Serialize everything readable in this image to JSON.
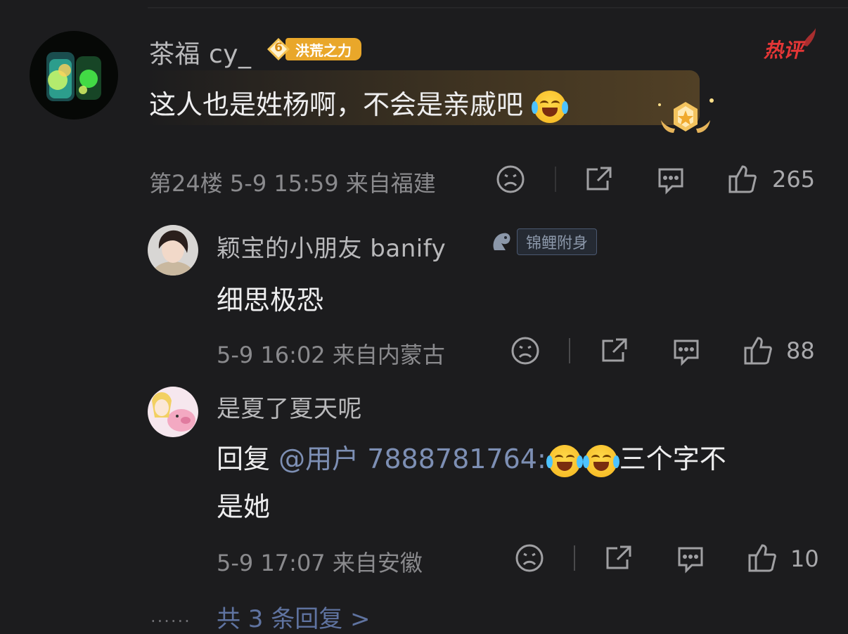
{
  "main_comment": {
    "username": "茶福 cy_",
    "level": "6",
    "badge_label": "洪荒之力",
    "hot_label": "热评",
    "text": "这人也是姓杨啊，不会是亲戚吧",
    "floor": "第24楼",
    "date": "5-9 15:59",
    "location": "来自福建",
    "likes": "265"
  },
  "replies": [
    {
      "username": "颖宝的小朋友 banify",
      "badge_label": "锦鲤附身",
      "text": "细思极恐",
      "date": "5-9 16:02",
      "location": "来自内蒙古",
      "likes": "88"
    },
    {
      "username": "是夏了夏天呢",
      "reply_prefix": "回复",
      "mention": "@用户 7888781764:",
      "text_after_emoji": "三个字不",
      "text_line2": "是她",
      "date": "5-9 17:07",
      "location": "来自安徽",
      "likes": "10"
    }
  ],
  "more_replies": "共 3 条回复 >",
  "icons": [
    "dislike-icon",
    "share-icon",
    "comment-icon",
    "like-icon",
    "laugh-cry-emoji"
  ],
  "colors": {
    "background": "#1c1c1e",
    "badge_orange": "#e9a72a",
    "hot_red": "#e43636",
    "mention_blue": "#7d8fb4"
  }
}
